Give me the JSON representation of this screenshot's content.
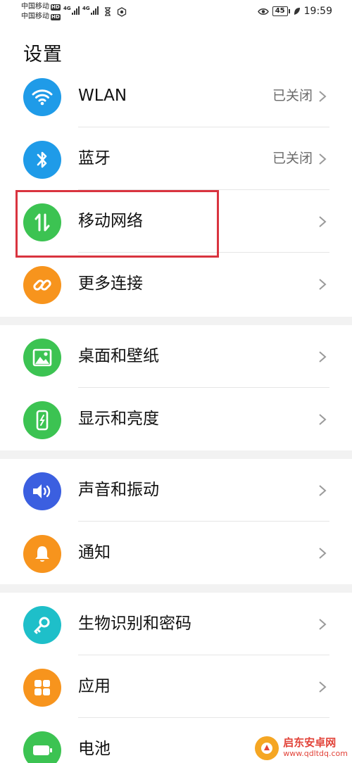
{
  "status_bar": {
    "carrier1": "中国移动",
    "carrier2": "中国移动",
    "hd": "HD",
    "net_tag": "4G",
    "battery": "45",
    "time": "19:59"
  },
  "page": {
    "title": "设置"
  },
  "groups": [
    [
      {
        "key": "wlan",
        "label": "WLAN",
        "value": "已关闭",
        "icon": "wifi-icon",
        "color": "#1f9be8"
      },
      {
        "key": "bluetooth",
        "label": "蓝牙",
        "value": "已关闭",
        "icon": "bluetooth-icon",
        "color": "#1f9be8"
      },
      {
        "key": "mobile-network",
        "label": "移动网络",
        "value": "",
        "icon": "mobile-data-icon",
        "color": "#3cc352"
      },
      {
        "key": "more-connections",
        "label": "更多连接",
        "value": "",
        "icon": "link-icon",
        "color": "#f7941d"
      }
    ],
    [
      {
        "key": "home-wallpaper",
        "label": "桌面和壁纸",
        "value": "",
        "icon": "image-icon",
        "color": "#3cc352"
      },
      {
        "key": "display-brightness",
        "label": "显示和亮度",
        "value": "",
        "icon": "phone-brightness-icon",
        "color": "#3cc352"
      }
    ],
    [
      {
        "key": "sound-vibration",
        "label": "声音和振动",
        "value": "",
        "icon": "speaker-icon",
        "color": "#3b5fe0"
      },
      {
        "key": "notifications",
        "label": "通知",
        "value": "",
        "icon": "bell-icon",
        "color": "#f7941d"
      }
    ],
    [
      {
        "key": "biometrics-password",
        "label": "生物识别和密码",
        "value": "",
        "icon": "key-icon",
        "color": "#1ebfc9"
      },
      {
        "key": "apps",
        "label": "应用",
        "value": "",
        "icon": "apps-grid-icon",
        "color": "#f7941d"
      },
      {
        "key": "battery",
        "label": "电池",
        "value": "",
        "icon": "battery-icon",
        "color": "#3cc352"
      }
    ]
  ],
  "watermark": {
    "name": "启东安卓网",
    "url": "www.qdltdq.com"
  }
}
